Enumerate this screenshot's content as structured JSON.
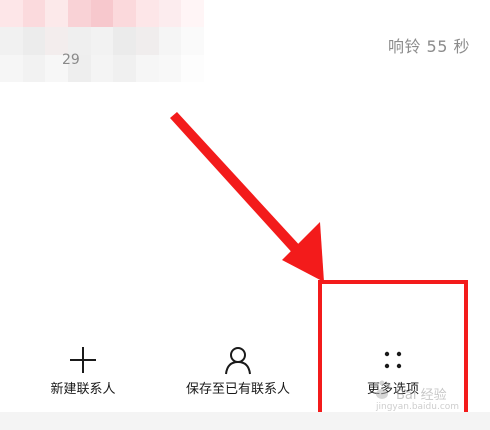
{
  "call_info": {
    "redacted_number_fragment": "29",
    "ring_duration": "响铃 55 秒"
  },
  "actions": [
    {
      "label": "新建联系人",
      "icon": "plus-icon"
    },
    {
      "label": "保存至已有联系人",
      "icon": "person-icon"
    },
    {
      "label": "更多选项",
      "icon": "four-dots-icon"
    }
  ],
  "watermark": {
    "logo_text": "Bai 经验",
    "url_text": "jingyan.baidu.com"
  },
  "colors": {
    "annotation_red": "#f31b1b",
    "label_text": "#1a1a1a",
    "secondary_text": "#8c8c8c"
  }
}
